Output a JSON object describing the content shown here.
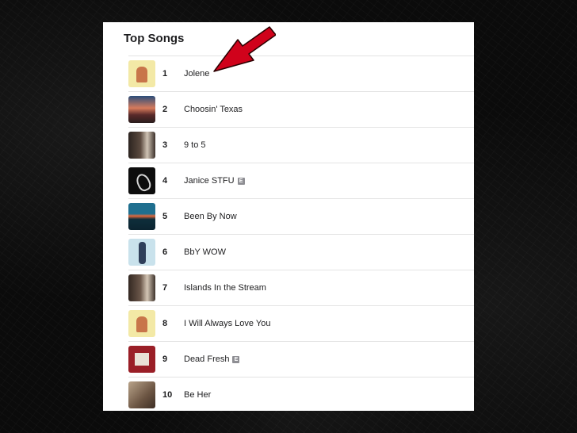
{
  "section_title": "Top Songs",
  "songs": [
    {
      "rank": "1",
      "title": "Jolene",
      "explicit": false,
      "art_icon": "jolene-album-art"
    },
    {
      "rank": "2",
      "title": "Choosin' Texas",
      "explicit": false,
      "art_icon": "choosin-texas-album-art"
    },
    {
      "rank": "3",
      "title": "9 to 5",
      "explicit": false,
      "art_icon": "9-to-5-album-art"
    },
    {
      "rank": "4",
      "title": "Janice STFU",
      "explicit": true,
      "art_icon": "janice-stfu-album-art"
    },
    {
      "rank": "5",
      "title": "Been By Now",
      "explicit": false,
      "art_icon": "been-by-now-album-art"
    },
    {
      "rank": "6",
      "title": "BbY WOW",
      "explicit": false,
      "art_icon": "bby-wow-album-art"
    },
    {
      "rank": "7",
      "title": "Islands In the Stream",
      "explicit": false,
      "art_icon": "islands-in-the-stream-album-art"
    },
    {
      "rank": "8",
      "title": "I Will Always Love You",
      "explicit": false,
      "art_icon": "i-will-always-love-you-album-art"
    },
    {
      "rank": "9",
      "title": "Dead Fresh",
      "explicit": true,
      "art_icon": "dead-fresh-album-art"
    },
    {
      "rank": "10",
      "title": "Be Her",
      "explicit": false,
      "art_icon": "be-her-album-art"
    }
  ],
  "explicit_badge": "E",
  "annotation_arrow_color": "#d0021b",
  "background_color": "#0b0b0b"
}
